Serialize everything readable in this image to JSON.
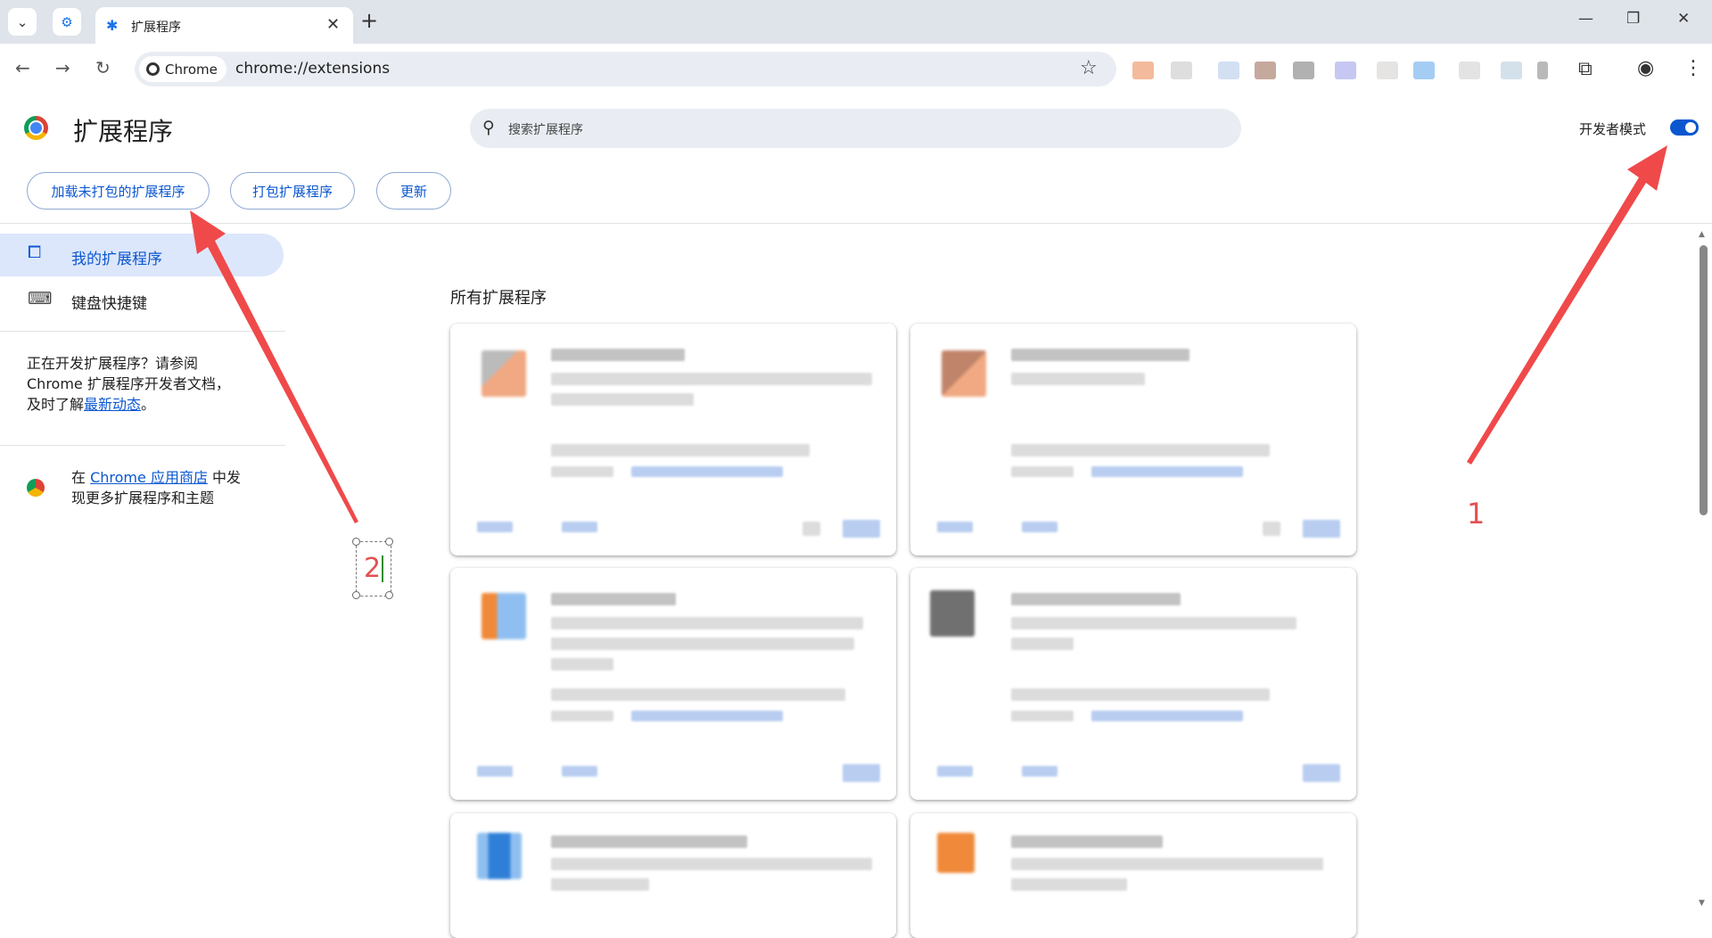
{
  "browser": {
    "tab_title": "扩展程序",
    "new_tab_symbol": "+",
    "close_symbol": "✕",
    "omnibox_chip": "Chrome",
    "url": "chrome://extensions"
  },
  "header": {
    "title": "扩展程序",
    "search_placeholder": "搜索扩展程序",
    "dev_mode_label": "开发者模式",
    "dev_mode_on": true
  },
  "actions": {
    "load_unpacked": "加载未打包的扩展程序",
    "pack": "打包扩展程序",
    "update": "更新"
  },
  "sidebar": {
    "items": [
      {
        "label": "我的扩展程序",
        "icon": "extension-icon",
        "active": true
      },
      {
        "label": "键盘快捷键",
        "icon": "keyboard-icon",
        "active": false
      }
    ],
    "dev_note_1": "正在开发扩展程序？请参阅",
    "dev_note_2": "Chrome 扩展程序开发者文档，",
    "dev_note_3_prefix": "及时了解",
    "dev_note_link": "最新动态",
    "dev_note_3_suffix": "。",
    "store_prefix": "在 ",
    "store_link": "Chrome 应用商店",
    "store_suffix_1": " 中发",
    "store_suffix_2": "现更多扩展程序和主题"
  },
  "main": {
    "section_title": "所有扩展程序"
  },
  "annotations": {
    "label_1": "1",
    "label_2": "2",
    "color": "#e25151"
  }
}
